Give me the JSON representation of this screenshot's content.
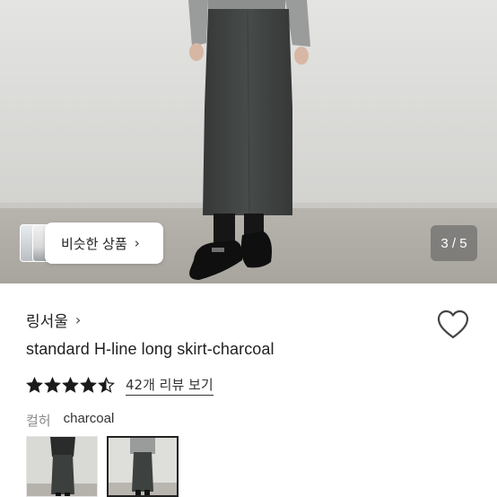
{
  "gallery": {
    "similar_label": "비슷한 상품",
    "similar_chevron": "›",
    "counter": "3 / 5"
  },
  "product": {
    "brand": "링서울",
    "brand_chevron": "›",
    "title": "standard H-line long skirt-charcoal",
    "rating": 4.5,
    "review_link": "42개 리뷰 보기",
    "color_label": "컬허",
    "color_value": "charcoal"
  },
  "icons": {
    "heart": "heart-outline-icon",
    "star": "star-icon",
    "chevron": "chevron-right-icon"
  },
  "colors": {
    "star": "#1a1a1a",
    "skirt": "#3d4140",
    "wall": "#dcdcda"
  }
}
